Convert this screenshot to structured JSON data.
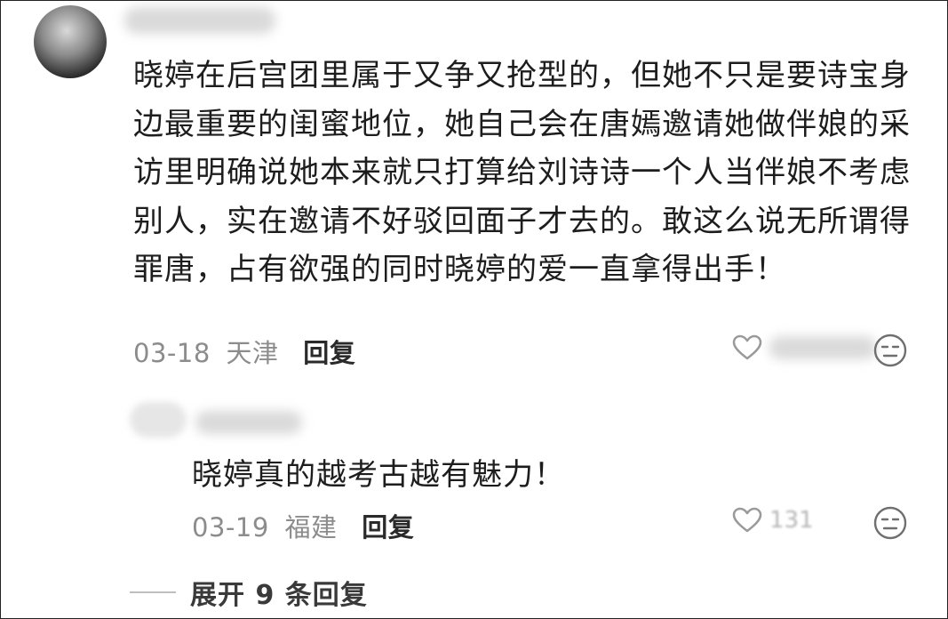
{
  "comment": {
    "text": "晓婷在后宫团里属于又争又抢型的，但她不只是要诗宝身边最重要的闺蜜地位，她自己会在唐嫣邀请她做伴娘的采访里明确说她本来就只打算给刘诗诗一个人当伴娘不考虑别人，实在邀请不好驳回面子才去的。敢这么说无所谓得罪唐，占有欲强的同时晓婷的爱一直拿得出手！",
    "date": "03-18",
    "location": "天津",
    "reply_label": "回复"
  },
  "reply": {
    "text": "晓婷真的越考古越有魅力！",
    "date": "03-19",
    "location": "福建",
    "reply_label": "回复",
    "like_count": "131"
  },
  "expand_label": "展开 9 条回复",
  "icons": {
    "like": "heart-outline-icon",
    "dislike": "neutral-face-icon"
  },
  "colors": {
    "text": "#1d1d1d",
    "meta": "#8c8c8c",
    "icon": "#9a9a9a"
  }
}
